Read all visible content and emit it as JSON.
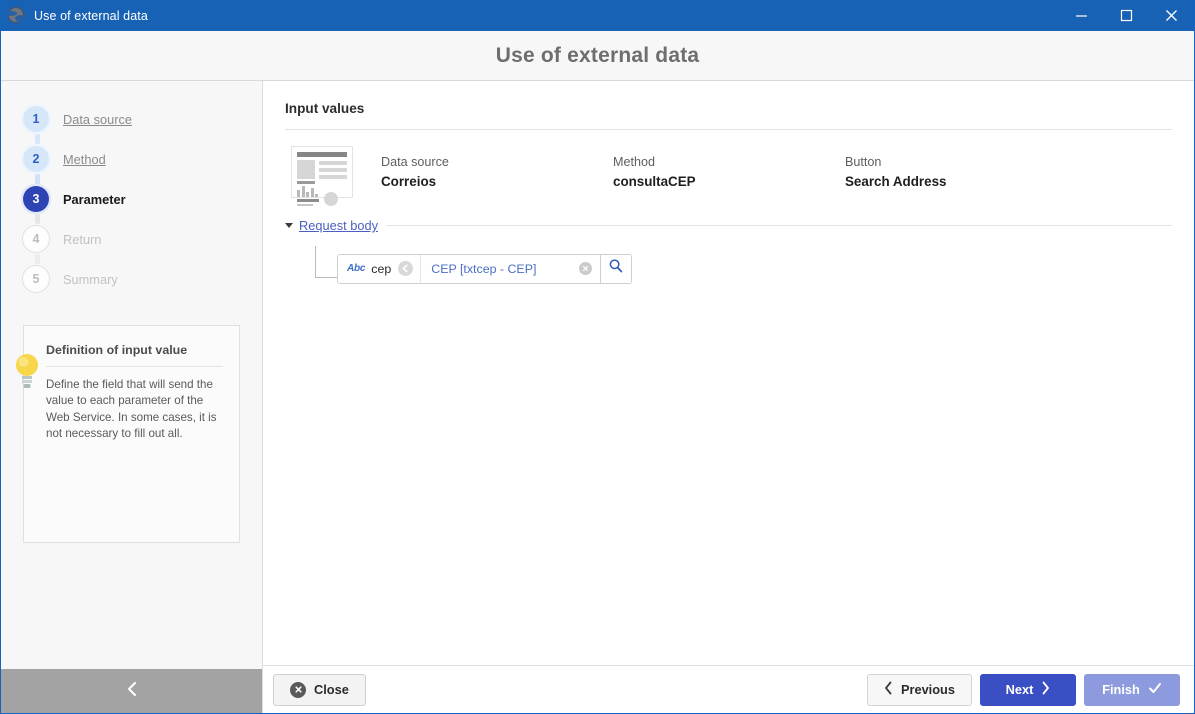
{
  "titlebar": {
    "title": "Use of external data",
    "icon": "globe-icon",
    "minimize": "—",
    "maximize": "□",
    "close": "✕"
  },
  "header": {
    "title": "Use of external data"
  },
  "sidebar": {
    "steps": [
      {
        "number": "1",
        "label": "Data source",
        "state": "done"
      },
      {
        "number": "2",
        "label": "Method",
        "state": "done"
      },
      {
        "number": "3",
        "label": "Parameter",
        "state": "current"
      },
      {
        "number": "4",
        "label": "Return",
        "state": "todo"
      },
      {
        "number": "5",
        "label": "Summary",
        "state": "todo"
      }
    ],
    "tip": {
      "icon": "lightbulb-icon",
      "title": "Definition of input value",
      "text": "Define the field that will send the value to each parameter of the Web Service. In some cases, it is not necessary to fill out all."
    },
    "collapse": {
      "icon": "chevron-left-icon"
    }
  },
  "main": {
    "section_title": "Input values",
    "summary": {
      "icon": "report-document-icon",
      "fields": [
        {
          "label": "Data source",
          "value": "Correios"
        },
        {
          "label": "Method",
          "value": "consultaCEP"
        },
        {
          "label": "Button",
          "value": "Search Address"
        }
      ]
    },
    "request_body": {
      "toggle_icon": "triangle-down-icon",
      "label": "Request body",
      "parameters": [
        {
          "type_badge": "Abc",
          "name": "cep",
          "map_icon": "arrow-left-circle-icon",
          "value": "CEP [txtcep - CEP]",
          "clear_icon": "clear-circle-icon",
          "search_icon": "magnifier-icon"
        }
      ]
    }
  },
  "footer": {
    "close": {
      "label": "Close",
      "icon": "close-circle-icon"
    },
    "previous": {
      "label": "Previous",
      "icon": "chevron-left-icon"
    },
    "next": {
      "label": "Next",
      "icon": "chevron-right-icon"
    },
    "finish": {
      "label": "Finish",
      "icon": "check-icon"
    }
  },
  "colors": {
    "titlebar": "#1862b5",
    "accent": "#3b4fc4",
    "finish": "#8d9ade",
    "link": "#4a5fc0",
    "step_current": "#2f44b4",
    "collapse_bar": "#a3a3a3"
  }
}
